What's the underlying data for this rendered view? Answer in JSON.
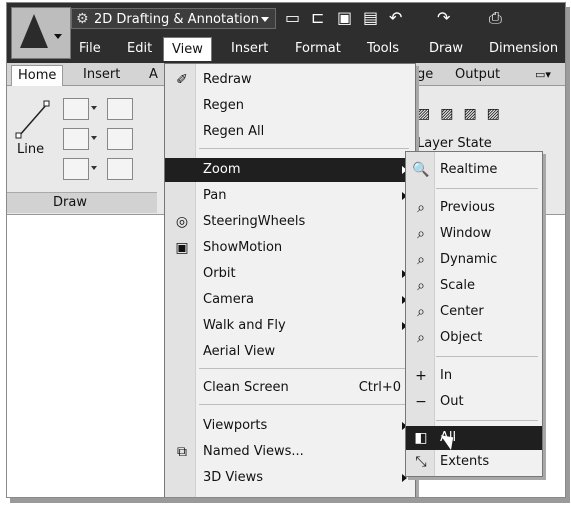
{
  "title_bar": {
    "workspace": "2D Drafting & Annotation"
  },
  "menubar": {
    "items": [
      "File",
      "Edit",
      "View",
      "Insert",
      "Format",
      "Tools",
      "Draw",
      "Dimension"
    ],
    "active": "View"
  },
  "ribbon_tabs": {
    "items": [
      "Home",
      "Insert",
      "A"
    ],
    "right_items": [
      "age",
      "Output"
    ],
    "active": "Home"
  },
  "ribbon": {
    "line_label": "Line",
    "draw_panel_label": "Draw",
    "layer_state_label": "Layer State"
  },
  "view_menu": {
    "items": [
      {
        "label": "Redraw",
        "icon": "redraw-icon"
      },
      {
        "label": "Regen"
      },
      {
        "label": "Regen All"
      },
      {
        "label": "Zoom",
        "submenu": true,
        "highlighted": true
      },
      {
        "label": "Pan",
        "submenu": true
      },
      {
        "label": "SteeringWheels",
        "icon": "steering-wheel-icon"
      },
      {
        "label": "ShowMotion",
        "icon": "showmotion-icon"
      },
      {
        "label": "Orbit",
        "submenu": true
      },
      {
        "label": "Camera",
        "submenu": true
      },
      {
        "label": "Walk and Fly",
        "submenu": true
      },
      {
        "label": "Aerial View"
      },
      {
        "label": "Clean Screen",
        "shortcut": "Ctrl+0"
      },
      {
        "label": "Viewports",
        "submenu": true
      },
      {
        "label": "Named Views...",
        "icon": "named-views-icon"
      },
      {
        "label": "3D Views",
        "submenu": true
      }
    ]
  },
  "zoom_submenu": {
    "items": [
      {
        "label": "Realtime",
        "icon": "zoom-realtime-icon"
      },
      {
        "label": "Previous",
        "icon": "zoom-previous-icon"
      },
      {
        "label": "Window",
        "icon": "zoom-window-icon"
      },
      {
        "label": "Dynamic",
        "icon": "zoom-dynamic-icon"
      },
      {
        "label": "Scale",
        "icon": "zoom-scale-icon"
      },
      {
        "label": "Center",
        "icon": "zoom-center-icon"
      },
      {
        "label": "Object",
        "icon": "zoom-object-icon"
      },
      {
        "label": "In",
        "icon": "zoom-in-icon"
      },
      {
        "label": "Out",
        "icon": "zoom-out-icon"
      },
      {
        "label": "All",
        "icon": "zoom-all-icon",
        "highlighted": true
      },
      {
        "label": "Extents",
        "icon": "zoom-extents-icon"
      }
    ]
  },
  "colors": {
    "titlebar": "#2e2e2e",
    "highlight": "#1f1f1f",
    "menu_bg": "#f1f1f1"
  }
}
